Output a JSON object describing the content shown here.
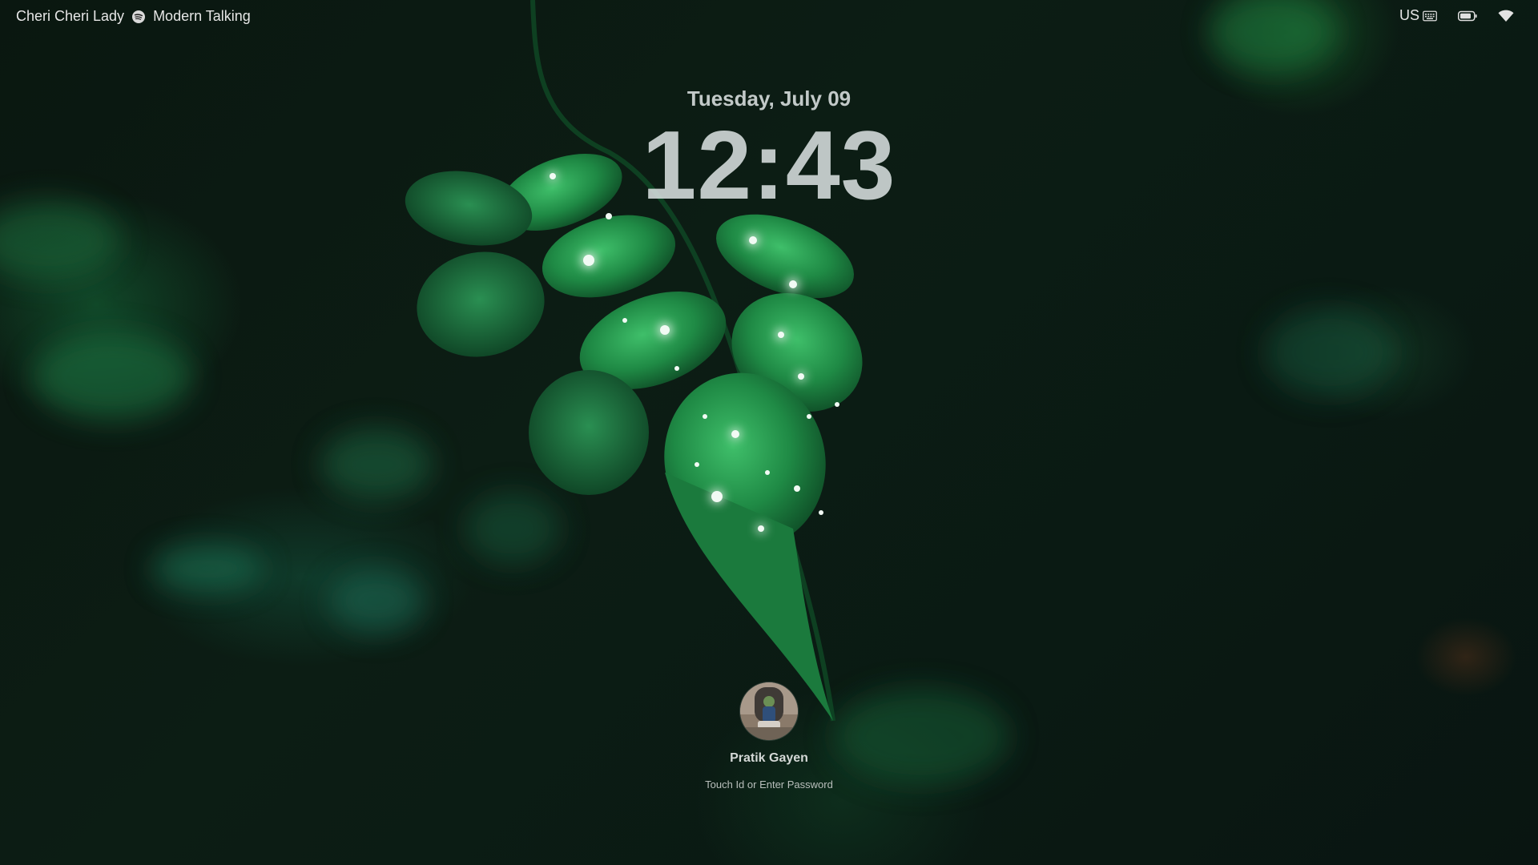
{
  "menubar": {
    "track_title": "Cheri Cheri Lady",
    "player_icon": "spotify-icon",
    "artist": "Modern Talking",
    "keyboard_layout": "US",
    "keyboard_icon": "keyboard-icon",
    "battery_icon": "battery-icon",
    "wifi_icon": "wifi-icon"
  },
  "lockscreen": {
    "date": "Tuesday, July 09",
    "time": "12:43"
  },
  "user": {
    "name": "Pratik Gayen",
    "hint": "Touch Id or Enter Password"
  },
  "colors": {
    "background": "#0b1a12",
    "leaf": "#1f8a45",
    "text": "#e6e6e6"
  }
}
